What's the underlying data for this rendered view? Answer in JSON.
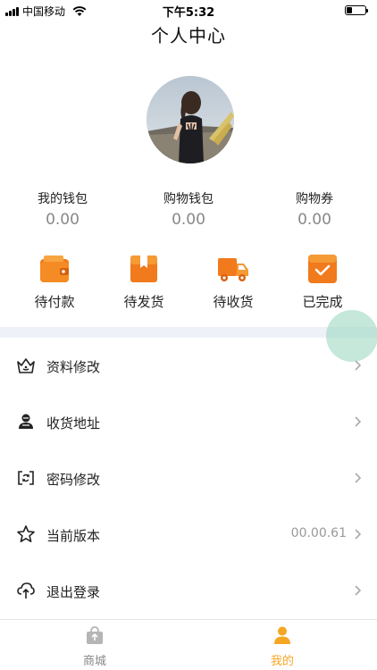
{
  "status_bar": {
    "carrier": "中国移动",
    "time": "下午5:32"
  },
  "header": {
    "title": "个人中心"
  },
  "wallets": [
    {
      "label": "我的钱包",
      "value": "0.00"
    },
    {
      "label": "购物钱包",
      "value": "0.00"
    },
    {
      "label": "购物券",
      "value": "0.00"
    }
  ],
  "orders": [
    {
      "label": "待付款",
      "icon": "wallet-icon"
    },
    {
      "label": "待发货",
      "icon": "package-icon"
    },
    {
      "label": "待收货",
      "icon": "truck-icon"
    },
    {
      "label": "已完成",
      "icon": "check-box-icon"
    }
  ],
  "menu": [
    {
      "label": "资料修改",
      "icon": "crown-icon",
      "value": ""
    },
    {
      "label": "收货地址",
      "icon": "contacts-icon",
      "value": ""
    },
    {
      "label": "密码修改",
      "icon": "refresh-lock-icon",
      "value": ""
    },
    {
      "label": "当前版本",
      "icon": "star-icon",
      "value": "00.00.61"
    },
    {
      "label": "退出登录",
      "icon": "upload-cloud-icon",
      "value": ""
    }
  ],
  "tab_bar": [
    {
      "label": "商城",
      "icon": "shop-bag-icon",
      "active": false
    },
    {
      "label": "我的",
      "icon": "person-icon",
      "active": true
    }
  ],
  "colors": {
    "accent_orange": "#f5a623",
    "icon_orange": "#f07a1c",
    "divider": "#eef2f8",
    "muted_text": "#999999"
  }
}
